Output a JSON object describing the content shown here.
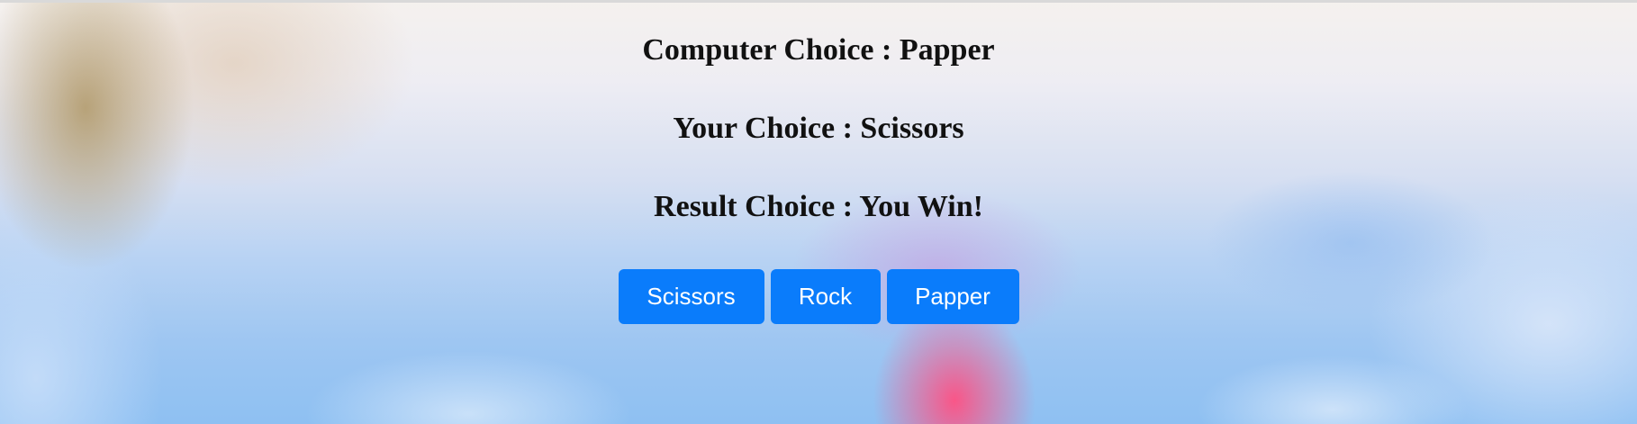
{
  "computer_choice": {
    "label": "Computer Choice",
    "separator": ":",
    "value": "Papper"
  },
  "your_choice": {
    "label": "Your Choice",
    "separator": ":",
    "value": "Scissors"
  },
  "result_choice": {
    "label": "Result Choice",
    "separator": ":",
    "value": "You Win!"
  },
  "buttons": {
    "scissors": "Scissors",
    "rock": "Rock",
    "papper": "Papper"
  },
  "colors": {
    "button_bg": "#0a7cfb",
    "button_text": "#ffffff",
    "heading_text": "#111111"
  }
}
